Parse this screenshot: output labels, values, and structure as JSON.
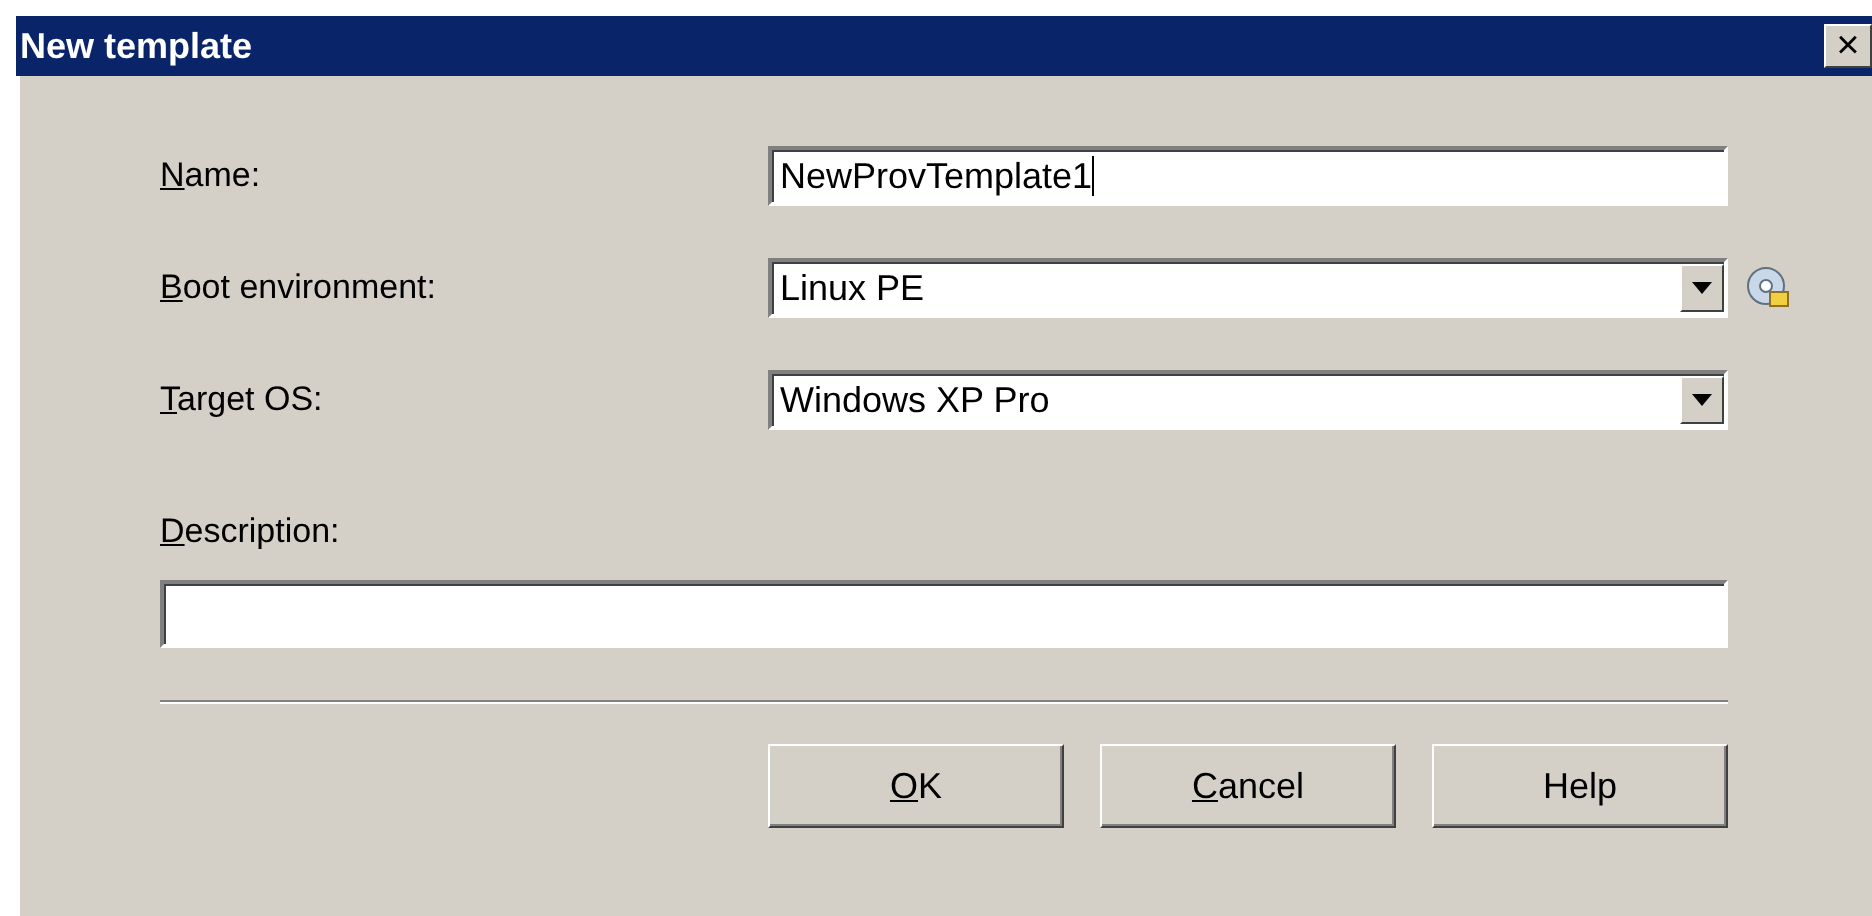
{
  "window": {
    "title": "New template",
    "close": "×"
  },
  "fields": [
    {
      "kind": "text",
      "label": "Name:",
      "mnemonic": true,
      "value": "NewProvTemplate1",
      "focused": true,
      "side_icon": false
    },
    {
      "kind": "dropdown",
      "label": "Boot environment:",
      "mnemonic": true,
      "value": "Linux PE",
      "focused": false,
      "side_icon": true
    },
    {
      "kind": "dropdown",
      "label": "Target OS:",
      "mnemonic": true,
      "value": "Windows XP Pro",
      "focused": false,
      "side_icon": false
    }
  ],
  "description": {
    "label": "Description:",
    "mnemonic": true
  },
  "buttons": [
    {
      "label": "OK",
      "mnemonic": true
    },
    {
      "label": "Cancel",
      "mnemonic": true
    },
    {
      "label": "Help",
      "mnemonic": false
    }
  ]
}
